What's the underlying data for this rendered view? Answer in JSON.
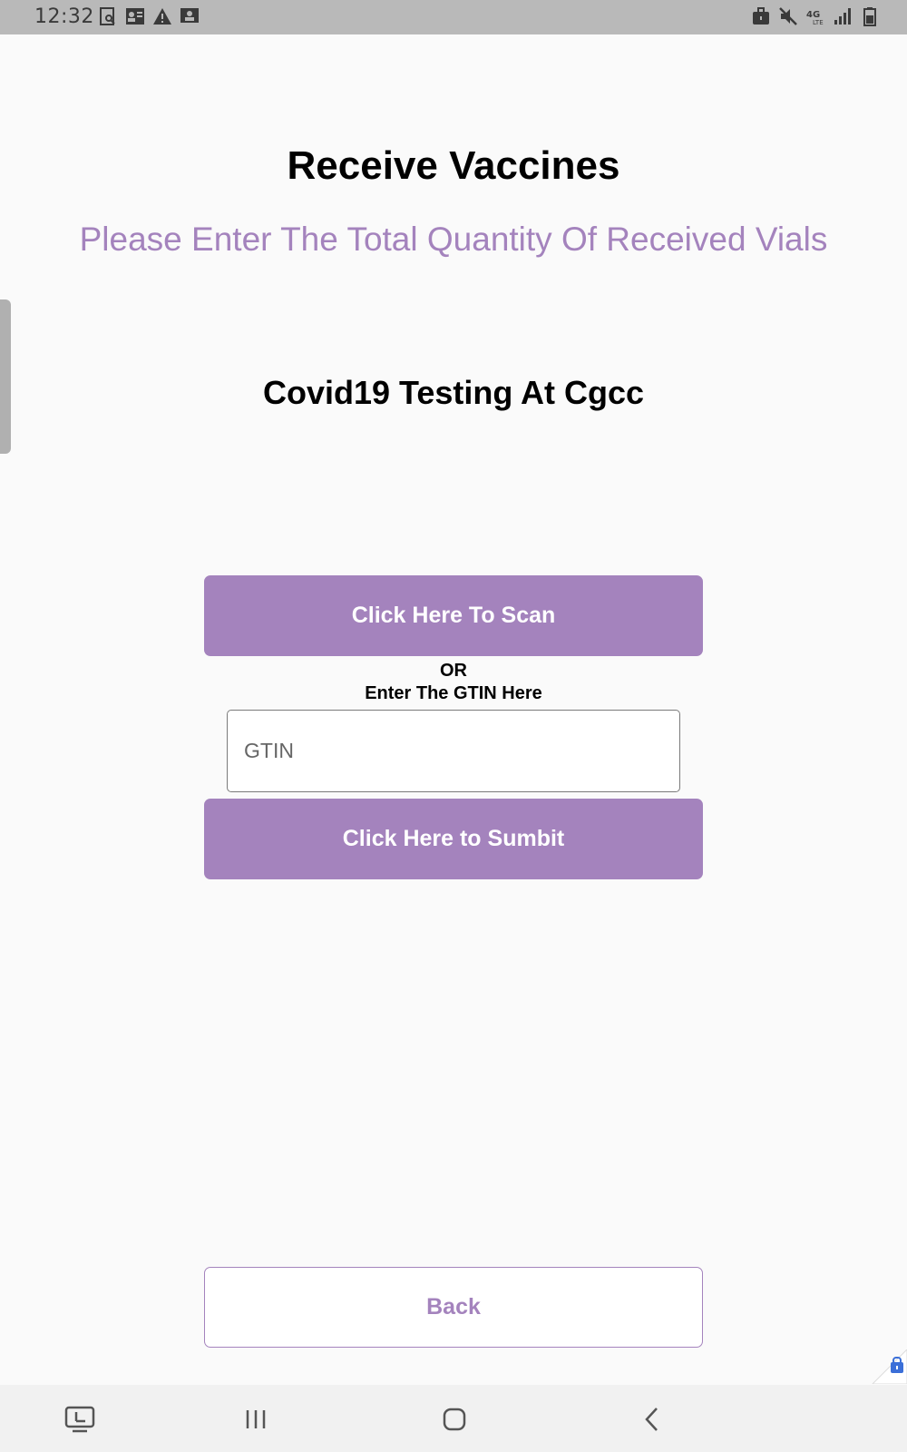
{
  "status_bar": {
    "time": "12:32",
    "left_icons": [
      "screenshot-icon",
      "contact-card-icon",
      "warning-icon",
      "image-notification-icon"
    ],
    "right_icons": [
      "briefcase-icon",
      "mute-icon",
      "4g-lte-icon",
      "signal-icon",
      "battery-icon"
    ]
  },
  "header": {
    "title": "Receive Vaccines",
    "subtitle": "Please Enter The Total Quantity Of Received Vials"
  },
  "site": {
    "name": "Covid19 Testing At Cgcc"
  },
  "scan": {
    "button_label": "Click Here To Scan"
  },
  "separator": {
    "or_label": "OR",
    "gtin_hint": "Enter The GTIN Here"
  },
  "gtin_field": {
    "value": "",
    "placeholder": "GTIN"
  },
  "submit": {
    "button_label": "Click Here to Sumbit"
  },
  "back": {
    "button_label": "Back"
  },
  "nav_bar": {
    "buttons": [
      "screen-share-icon",
      "recent-apps-icon",
      "home-icon",
      "back-arrow-icon"
    ]
  },
  "colors": {
    "accent": "#a483bd",
    "background": "#fafafa",
    "status_bar": "#b9b9b9",
    "nav_bar": "#f1f1f1"
  }
}
